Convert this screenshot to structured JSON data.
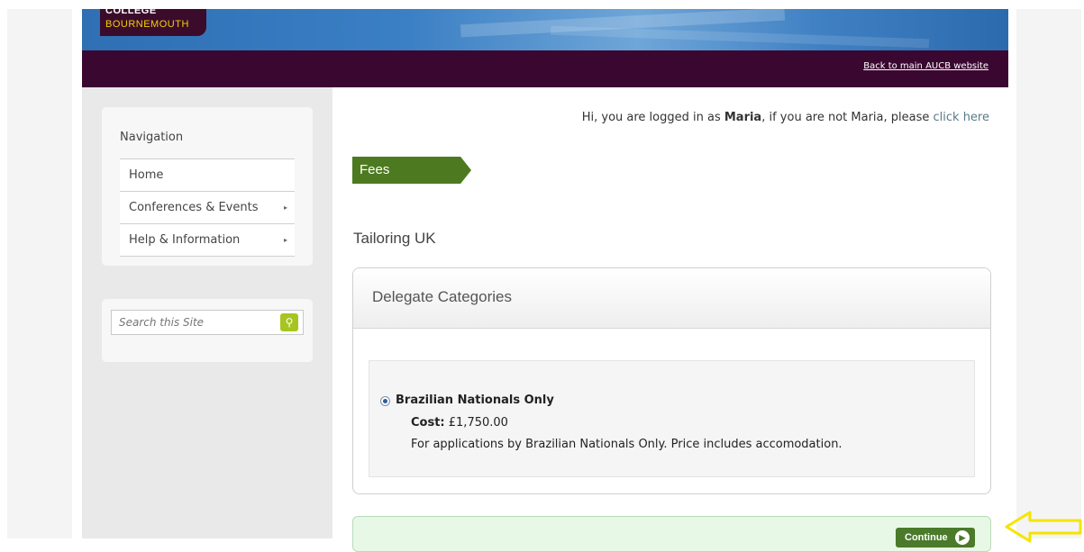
{
  "header": {
    "logo_line1": "COLLEGE",
    "logo_line2": "BOURNEMOUTH",
    "back_link": "Back to main AUCB website"
  },
  "sidebar": {
    "nav_title": "Navigation",
    "items": [
      {
        "label": "Home",
        "has_submenu": false
      },
      {
        "label": "Conferences & Events",
        "has_submenu": true
      },
      {
        "label": "Help & Information",
        "has_submenu": true
      }
    ],
    "search_placeholder": "Search this Site"
  },
  "main": {
    "greeting_prefix": "Hi, you are logged in as ",
    "user_name": "Maria",
    "greeting_mid": ", if you are not Maria, please ",
    "click_here": "click here",
    "section_tab": "Fees",
    "event_title": "Tailoring UK",
    "categories_title": "Delegate Categories",
    "option": {
      "name": "Brazilian Nationals Only",
      "cost_label": "Cost:",
      "cost_value": "£1,750.00",
      "description": "For applications by Brazilian Nationals Only. Price includes accomodation.",
      "selected": true
    },
    "continue_label": "Continue"
  },
  "colors": {
    "header_purple": "#3a0730",
    "fees_green": "#4d7a20",
    "search_green": "#a7c520",
    "highlight_arrow": "#f5e400"
  },
  "icons": {
    "search": "search-icon",
    "submenu": "chevron-right-icon",
    "continue": "arrow-circle-icon",
    "annotation": "left-arrow-icon"
  }
}
